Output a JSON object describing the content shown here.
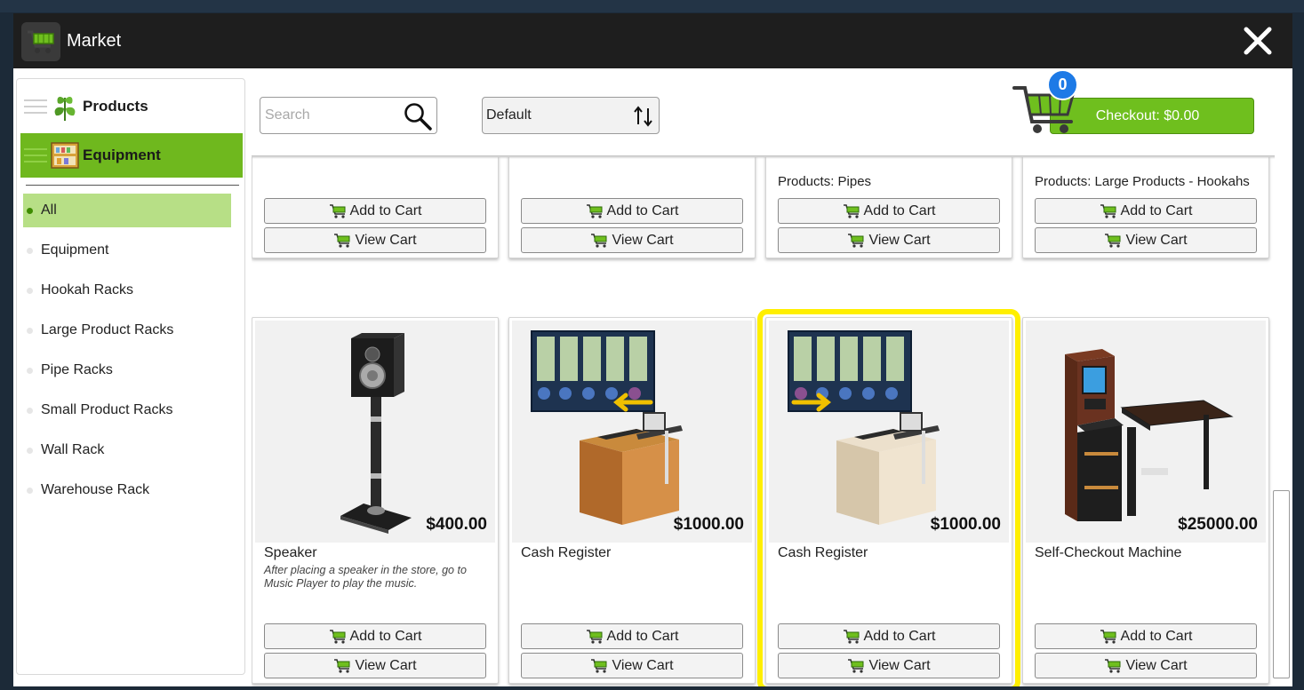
{
  "window": {
    "title": "Market",
    "close_glyph": "✕"
  },
  "sidebar": {
    "categories": [
      {
        "label": "Products",
        "icon": "leaf-icon",
        "active": false
      },
      {
        "label": "Equipment",
        "icon": "shelf-icon",
        "active": true
      }
    ],
    "subcategories": [
      {
        "label": "All",
        "active": true
      },
      {
        "label": "Equipment",
        "active": false
      },
      {
        "label": "Hookah Racks",
        "active": false
      },
      {
        "label": "Large Product Racks",
        "active": false
      },
      {
        "label": "Pipe Racks",
        "active": false
      },
      {
        "label": "Small Product Racks",
        "active": false
      },
      {
        "label": "Wall Rack",
        "active": false
      },
      {
        "label": "Warehouse Rack",
        "active": false
      }
    ]
  },
  "toolbar": {
    "search_placeholder": "Search",
    "search_value": "",
    "sort_value": "Default",
    "cart_count": "0",
    "checkout_label": "Checkout: $0.00"
  },
  "buttons": {
    "add_to_cart": "Add to Cart",
    "view_cart": "View Cart"
  },
  "top_row": [
    {
      "category_line": ""
    },
    {
      "category_line": ""
    },
    {
      "category_line": "Products: Pipes"
    },
    {
      "category_line": "Products: Large Products - Hookahs"
    }
  ],
  "products": [
    {
      "name": "Speaker",
      "price": "$400.00",
      "description": "After placing a speaker in the store, go to Music Player to play the music.",
      "image": "speaker-image",
      "highlighted": false
    },
    {
      "name": "Cash Register",
      "price": "$1000.00",
      "description": "",
      "image": "cash-register-wood-image",
      "highlighted": false
    },
    {
      "name": "Cash Register",
      "price": "$1000.00",
      "description": "",
      "image": "cash-register-light-image",
      "highlighted": true
    },
    {
      "name": "Self-Checkout Machine",
      "price": "$25000.00",
      "description": "",
      "image": "self-checkout-image",
      "highlighted": false
    }
  ],
  "colors": {
    "titlebar": "#1e1e1e",
    "accent_green": "#6fb81e",
    "active_sub": "#b7df86",
    "highlight": "#ffef00",
    "badge": "#1d7ae6"
  }
}
